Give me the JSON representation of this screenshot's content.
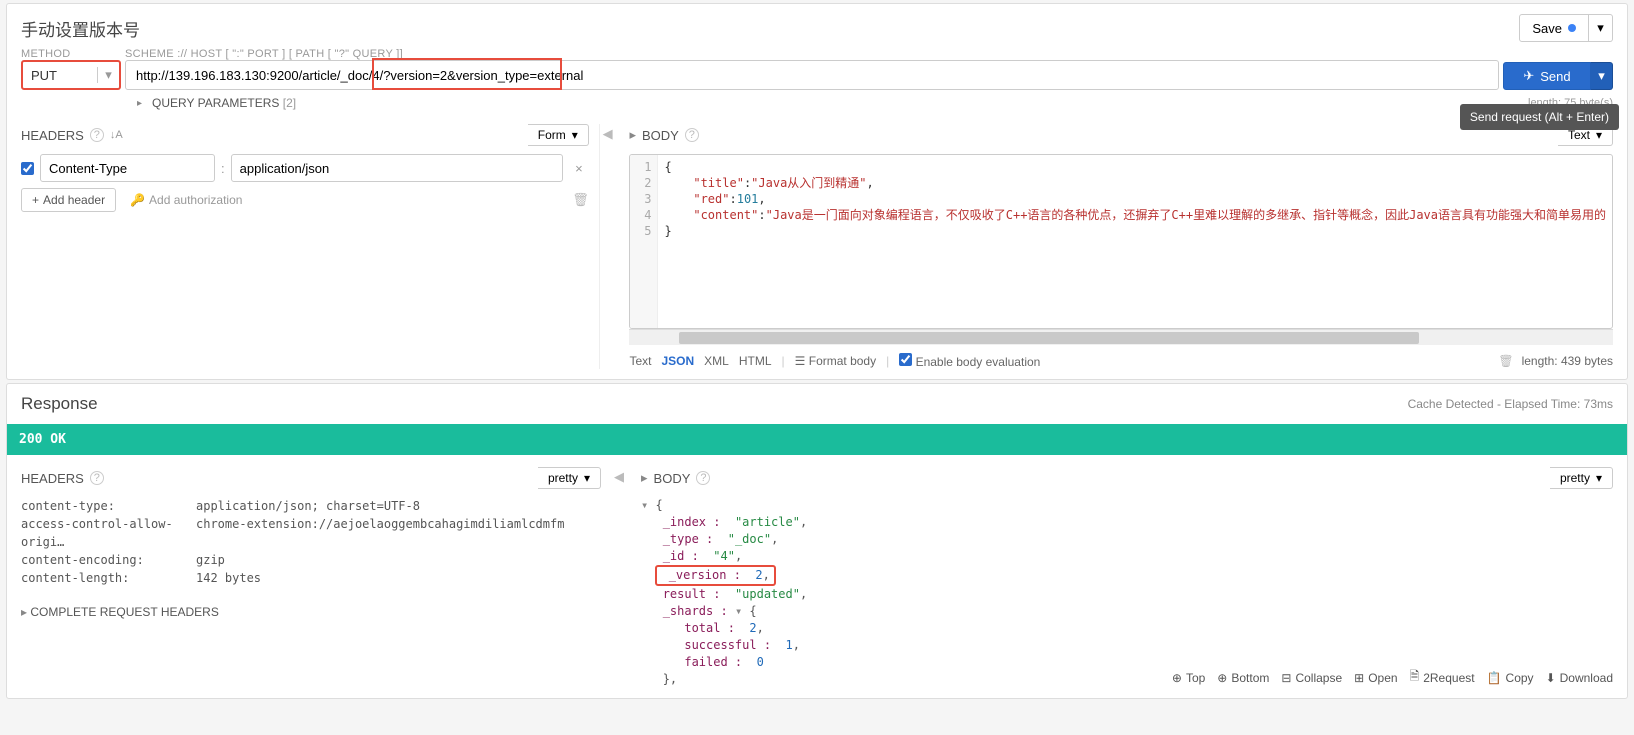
{
  "header": {
    "title": "手动设置版本号",
    "save": "Save"
  },
  "request": {
    "method_label": "METHOD",
    "method": "PUT",
    "scheme_label": "SCHEME :// HOST [ \":\" PORT ] [ PATH [ \"?\" QUERY ]]",
    "url": "http://139.196.183.130:9200/article/_doc/4/?version=2&version_type=external",
    "send": "Send",
    "tooltip": "Send request (Alt + Enter)",
    "length": "length: 75 byte(s)",
    "query_params": "QUERY PARAMETERS",
    "query_params_count": "[2]"
  },
  "headers_section": {
    "title": "HEADERS",
    "form_label": "Form",
    "rows": [
      {
        "name": "Content-Type",
        "value": "application/json"
      }
    ],
    "add_header": "Add header",
    "add_auth": "Add authorization"
  },
  "body_section": {
    "title": "BODY",
    "text_label": "Text",
    "lines": [
      "1",
      "2",
      "3",
      "4",
      "5"
    ],
    "code": {
      "l1": "{",
      "l2_k": "\"title\"",
      "l2_c": ":",
      "l2_v": "\"Java从入门到精通\"",
      "l2_e": ",",
      "l3_k": "\"red\"",
      "l3_c": ":",
      "l3_v": "101",
      "l3_e": ",",
      "l4_k": "\"content\"",
      "l4_c": ":",
      "l4_v": "\"Java是一门面向对象编程语言，不仅吸收了C++语言的各种优点，还摒弃了C++里难以理解的多继承、指针等概念，因此Java语言具有功能强大和简单易用的",
      "l5": "}"
    },
    "footer": {
      "text": "Text",
      "json": "JSON",
      "xml": "XML",
      "html": "HTML",
      "format": "Format body",
      "eval": "Enable body evaluation",
      "length": "length: 439 bytes"
    }
  },
  "response": {
    "title": "Response",
    "cache": "Cache Detected - Elapsed Time: 73ms",
    "status": "200  OK",
    "headers_title": "HEADERS",
    "body_title": "BODY",
    "pretty": "pretty",
    "headers": [
      {
        "k": "content-type:",
        "v": "application/json; charset=UTF-8"
      },
      {
        "k": "access-control-allow-origi…",
        "v": "chrome-extension://aejoelaoggembcahagimdiliamlcdmfm"
      },
      {
        "k": "content-encoding:",
        "v": "gzip"
      },
      {
        "k": "content-length:",
        "v": "142 bytes"
      }
    ],
    "complete_headers": "COMPLETE REQUEST HEADERS",
    "json": {
      "index_k": "_index :",
      "index_v": "\"article\"",
      "type_k": "_type :",
      "type_v": "\"_doc\"",
      "id_k": "_id :",
      "id_v": "\"4\"",
      "version_k": "_version :",
      "version_v": "2",
      "result_k": "result :",
      "result_v": "\"updated\"",
      "shards_k": "_shards :",
      "total_k": "total :",
      "total_v": "2",
      "successful_k": "successful :",
      "successful_v": "1",
      "failed_k": "failed :",
      "failed_v": "0"
    },
    "actions": {
      "top": "Top",
      "bottom": "Bottom",
      "collapse": "Collapse",
      "open": "Open",
      "torequest": "2Request",
      "copy": "Copy",
      "download": "Download"
    }
  }
}
